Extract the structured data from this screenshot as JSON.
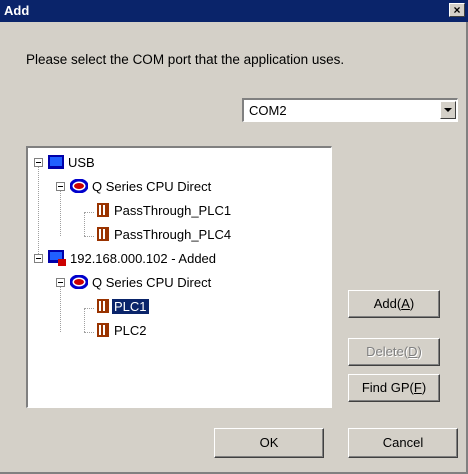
{
  "window": {
    "title": "Add",
    "close_label": "×"
  },
  "instruction": "Please select the COM port that the application uses.",
  "com_port": {
    "selected": "COM2"
  },
  "tree": {
    "usb": {
      "label": "USB"
    },
    "usb_driver": {
      "label": "Q Series CPU Direct"
    },
    "usb_plc1": {
      "label": "PassThrough_PLC1"
    },
    "usb_plc4": {
      "label": "PassThrough_PLC4"
    },
    "ip": {
      "label": "192.168.000.102 - Added"
    },
    "ip_driver": {
      "label": "Q Series CPU Direct"
    },
    "ip_plc1": {
      "label": "PLC1"
    },
    "ip_plc2": {
      "label": "PLC2"
    }
  },
  "buttons": {
    "add": {
      "label": "Add(",
      "mnemonic": "A",
      "tail": ")"
    },
    "delete": {
      "label": "Delete(",
      "mnemonic": "D",
      "tail": ")"
    },
    "find_gp": {
      "label": "Find GP(",
      "mnemonic": "F",
      "tail": ")"
    },
    "ok": {
      "label": "OK"
    },
    "cancel": {
      "label": "Cancel"
    }
  },
  "colors": {
    "title_bar": "#0a246a",
    "face": "#d4d0c8",
    "selection": "#0a246a"
  }
}
